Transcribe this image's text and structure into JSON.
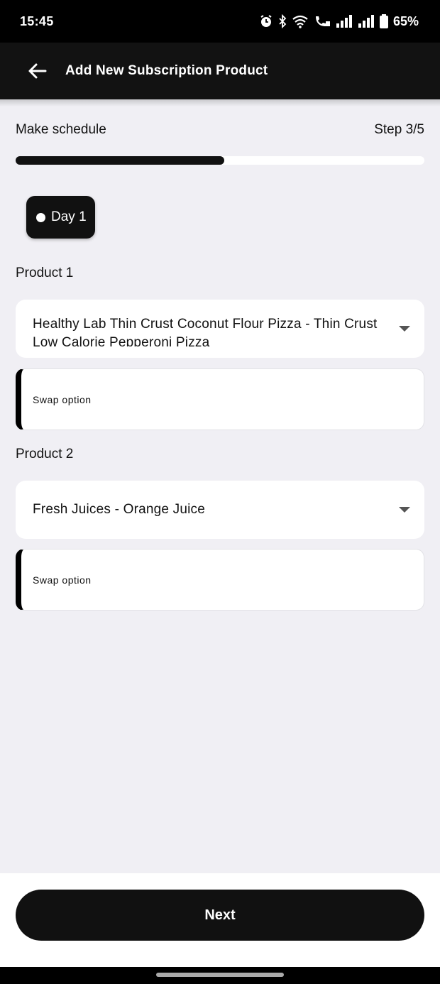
{
  "status_bar": {
    "time": "15:45",
    "battery": "65%",
    "icons": [
      "alarm-icon",
      "bluetooth-icon",
      "wifi-icon",
      "wifi-call-icon",
      "signal-icon",
      "signal-icon",
      "battery-icon"
    ]
  },
  "app_bar": {
    "title": "Add New Subscription Product",
    "back_icon": "arrow-left-icon"
  },
  "schedule": {
    "label": "Make schedule",
    "step": "Step 3/5",
    "progress": 0.51
  },
  "day_chip": {
    "label": "Day 1"
  },
  "products": [
    {
      "label": "Product 1",
      "selected": "Healthy Lab Thin Crust Coconut Flour Pizza - Thin Crust Low Calorie Pepperoni Pizza",
      "swap_placeholder": "Swap option"
    },
    {
      "label": "Product 2",
      "selected": "Fresh Juices - Orange Juice",
      "swap_placeholder": "Swap option"
    }
  ],
  "footer": {
    "next_label": "Next"
  },
  "colors": {
    "primary": "#111111",
    "background": "#f0eff4",
    "surface": "#ffffff"
  }
}
